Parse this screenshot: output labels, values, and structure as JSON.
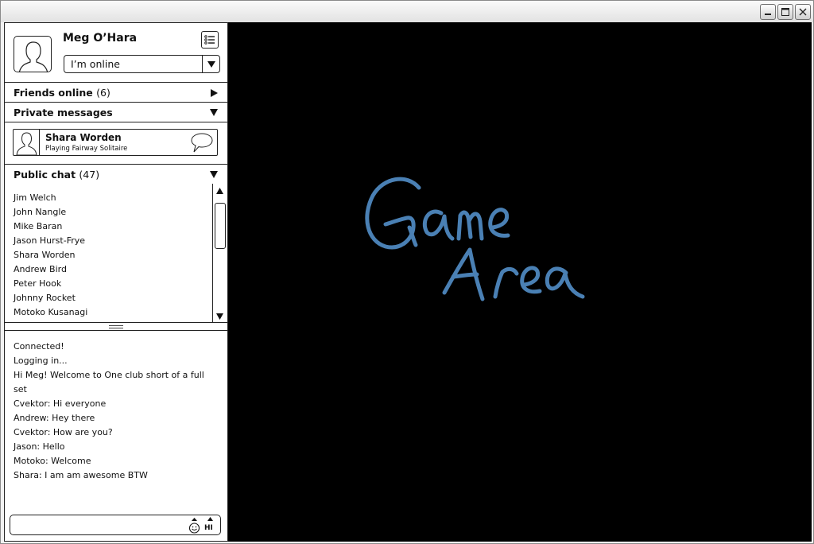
{
  "profile": {
    "name": "Meg O’Hara",
    "status": "I’m online",
    "avatar_icon": "user-silhouette-icon",
    "menu_icon": "list-menu-icon"
  },
  "sections": {
    "friends_online": {
      "label": "Friends online",
      "count": "(6)",
      "expanded": false
    },
    "private_messages": {
      "label": "Private messages",
      "expanded": true
    },
    "public_chat": {
      "label": "Public chat",
      "count": "(47)",
      "expanded": true
    }
  },
  "private_message": {
    "name": "Shara Worden",
    "status": "Playing Fairway Solitaire",
    "icon": "speech-bubble-icon"
  },
  "users": [
    "Jim Welch",
    "John Nangle",
    "Mike Baran",
    "Jason Hurst-Frye",
    "Shara Worden",
    "Andrew Bird",
    "Peter Hook",
    "Johnny Rocket",
    "Motoko Kusanagi"
  ],
  "chat": [
    "Connected!",
    "Logging in...",
    "Hi Meg! Welcome to One club short of a full set",
    "Cvektor: Hi everyone",
    "Andrew: Hey there",
    "Cvektor: How are you?",
    "Jason: Hello",
    "Motoko: Welcome",
    "Shara: I am am awesome BTW"
  ],
  "input": {
    "value": "",
    "hi_label": "HI"
  },
  "game_area": {
    "line1": "Game",
    "line2": "Area",
    "ink_color": "#4a80b4",
    "background": "#000000"
  },
  "window_buttons": [
    "minimize-icon",
    "maximize-icon",
    "close-icon"
  ]
}
